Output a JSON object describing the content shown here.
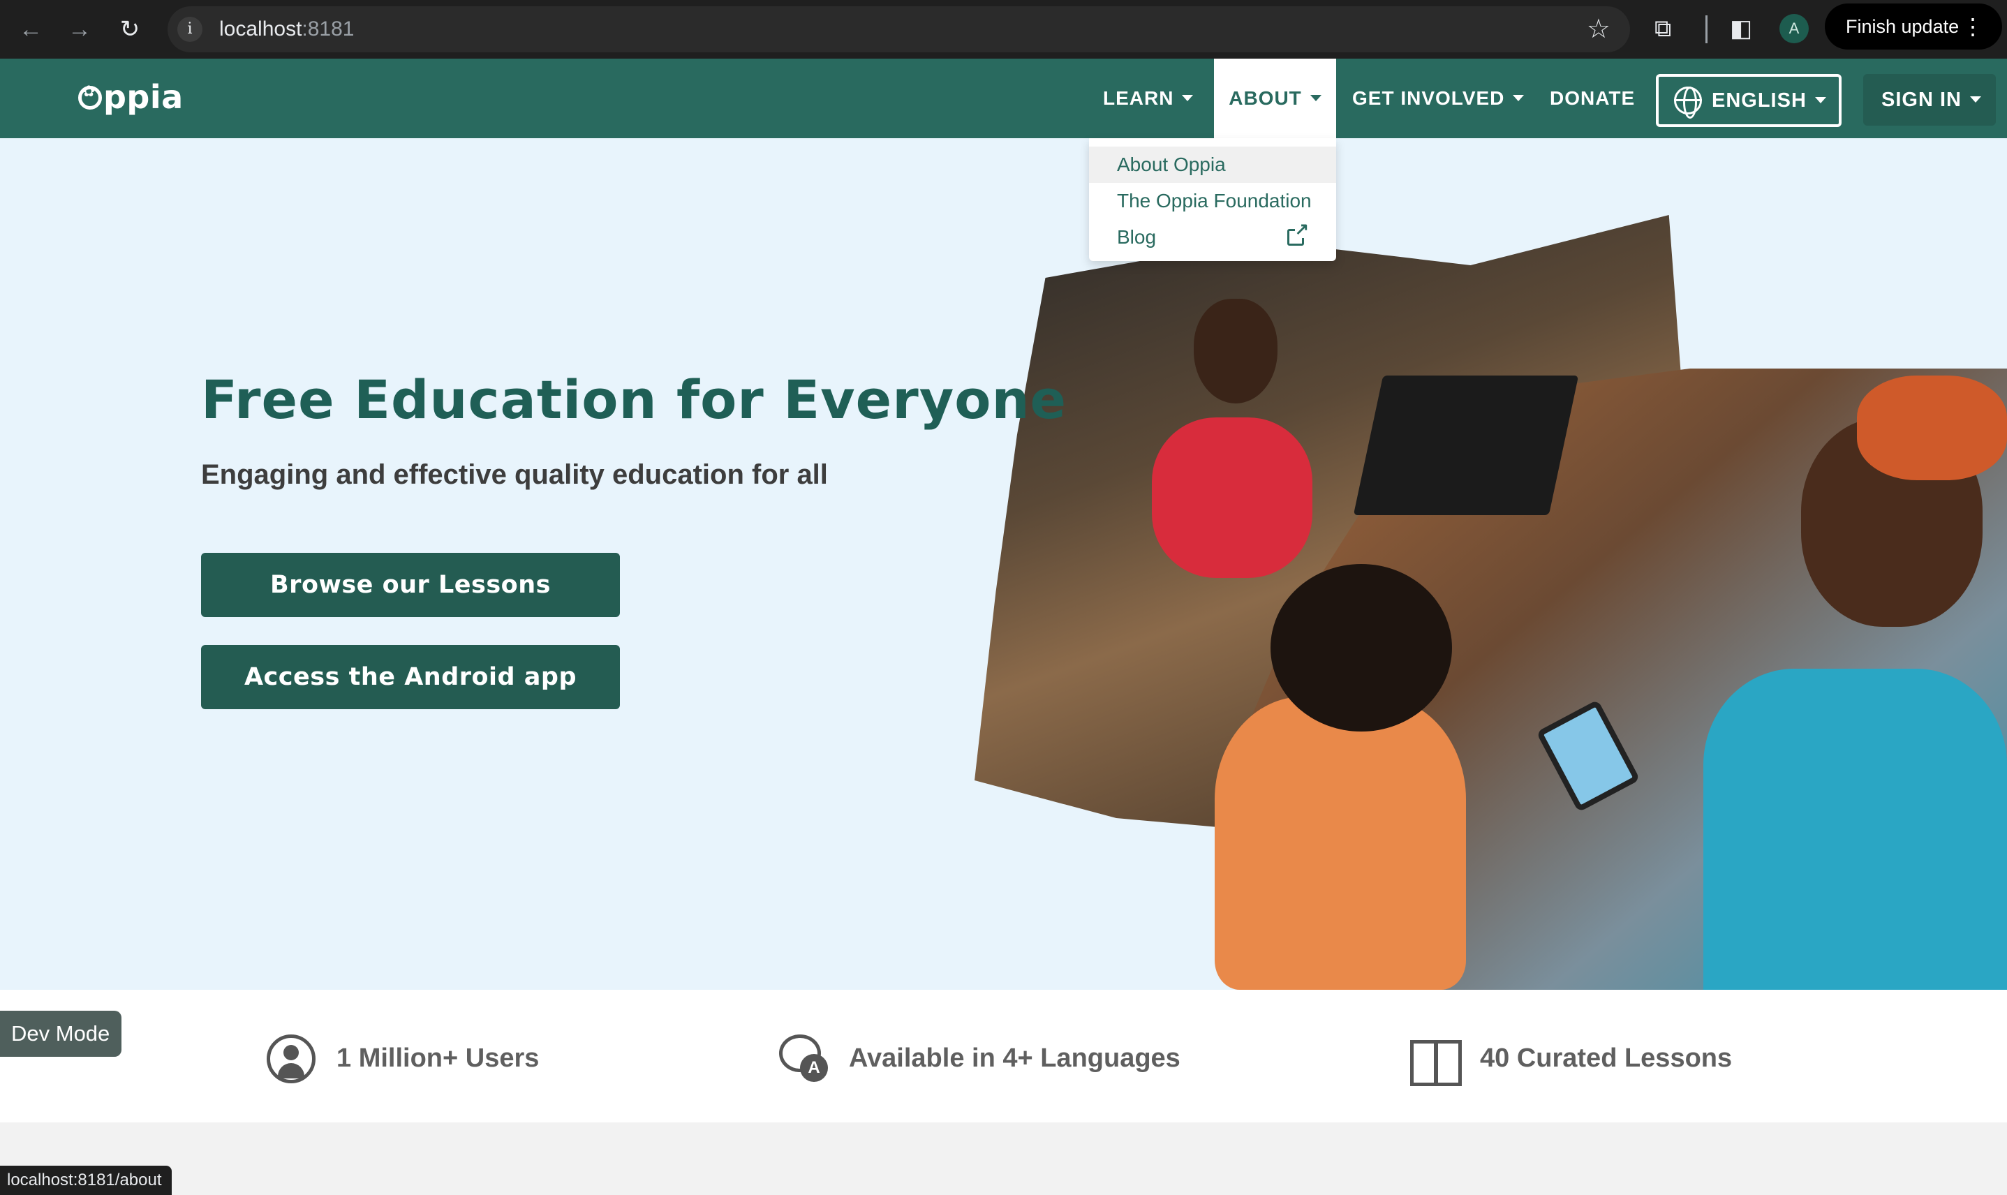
{
  "browser": {
    "back_icon": "arrow-left-icon",
    "forward_icon": "arrow-right-icon",
    "reload_icon": "reload-icon",
    "url_host": "localhost",
    "url_port": ":8181",
    "bookmark_icon": "star-icon",
    "extensions_icon": "puzzle-icon",
    "sidepanel_icon": "side-panel-icon",
    "profile_initial": "A",
    "finish_update_label": "Finish update",
    "menu_icon": "kebab-menu-icon",
    "status_url": "localhost:8181/about"
  },
  "navbar": {
    "logo": "ppia",
    "items": [
      {
        "label": "LEARN"
      },
      {
        "label": "ABOUT"
      },
      {
        "label": "GET INVOLVED"
      },
      {
        "label": "DONATE"
      }
    ],
    "language_label": "ENGLISH",
    "signin_label": "SIGN IN"
  },
  "about_dropdown": {
    "items": [
      {
        "label": "About Oppia"
      },
      {
        "label": "The Oppia Foundation"
      },
      {
        "label": "Blog"
      }
    ]
  },
  "hero": {
    "title": "Free Education for Everyone",
    "subtitle": "Engaging and effective quality education for all",
    "browse_button": "Browse our Lessons",
    "android_button": "Access the Android app"
  },
  "stats": [
    {
      "icon": "user-circle-icon",
      "text": "1 Million+ Users"
    },
    {
      "icon": "languages-icon",
      "text": "Available in 4+ Languages"
    },
    {
      "icon": "open-book-icon",
      "text": "40 Curated Lessons"
    }
  ],
  "dev_mode_label": "Dev Mode",
  "colors": {
    "brand_green": "#296a5f",
    "button_green": "#245c52",
    "hero_background": "#e8f4fc"
  }
}
